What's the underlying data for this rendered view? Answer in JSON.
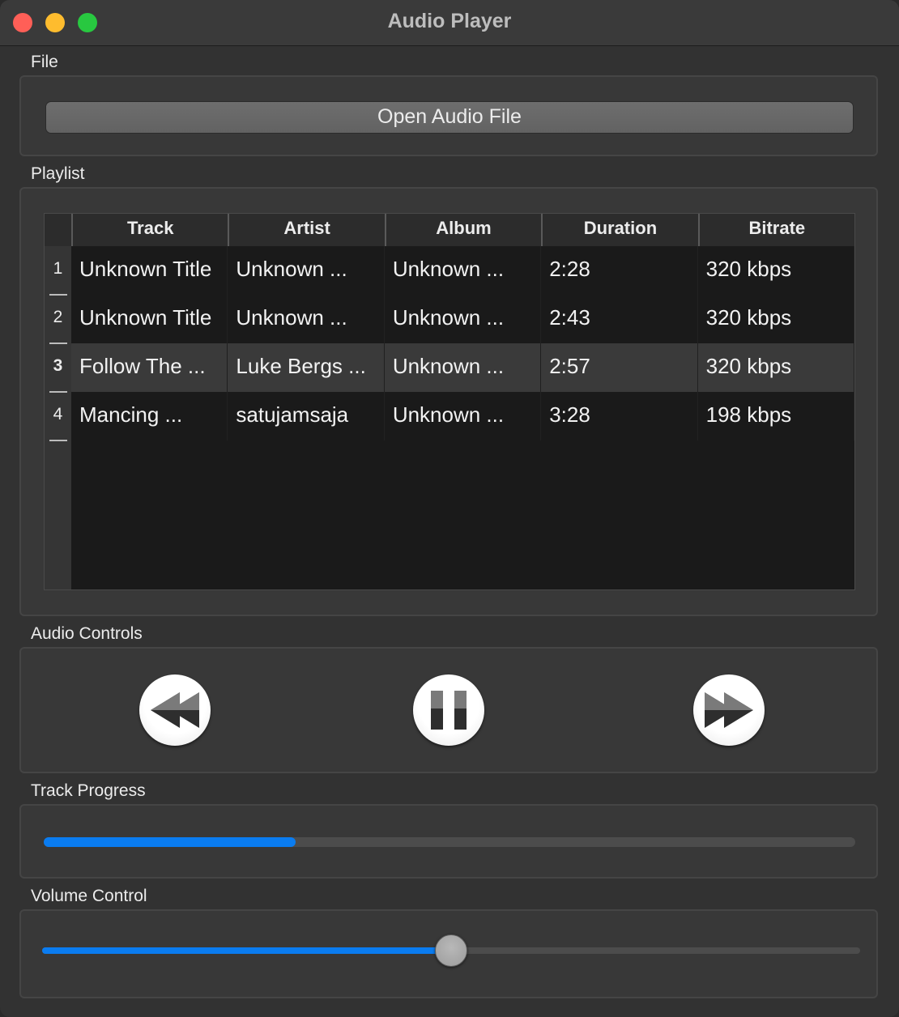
{
  "window": {
    "title": "Audio Player"
  },
  "file": {
    "label": "File",
    "open_button": "Open Audio File"
  },
  "playlist": {
    "label": "Playlist",
    "columns": [
      "Track",
      "Artist",
      "Album",
      "Duration",
      "Bitrate"
    ],
    "rows": [
      {
        "num": "1",
        "track": "Unknown Title",
        "artist": "Unknown ...",
        "album": "Unknown ...",
        "duration": "2:28",
        "bitrate": "320 kbps"
      },
      {
        "num": "2",
        "track": "Unknown Title",
        "artist": "Unknown ...",
        "album": "Unknown ...",
        "duration": "2:43",
        "bitrate": "320 kbps"
      },
      {
        "num": "3",
        "track": "Follow The ...",
        "artist": "Luke Bergs ...",
        "album": "Unknown ...",
        "duration": "2:57",
        "bitrate": "320 kbps"
      },
      {
        "num": "4",
        "track": "Mancing ...",
        "artist": "satujamsaja",
        "album": "Unknown ...",
        "duration": "3:28",
        "bitrate": "198 kbps"
      }
    ],
    "selected_row": 3
  },
  "controls": {
    "label": "Audio Controls",
    "rewind_icon": "rewind-icon",
    "pause_icon": "pause-icon",
    "fast_forward_icon": "fast-forward-icon"
  },
  "progress": {
    "label": "Track Progress",
    "value_fraction": 0.31
  },
  "volume": {
    "label": "Volume Control",
    "value_fraction": 0.5
  },
  "colors": {
    "accent": "#0a7cf0",
    "close": "#ff5f57",
    "minimize": "#febc2e",
    "maximize": "#28c840"
  }
}
